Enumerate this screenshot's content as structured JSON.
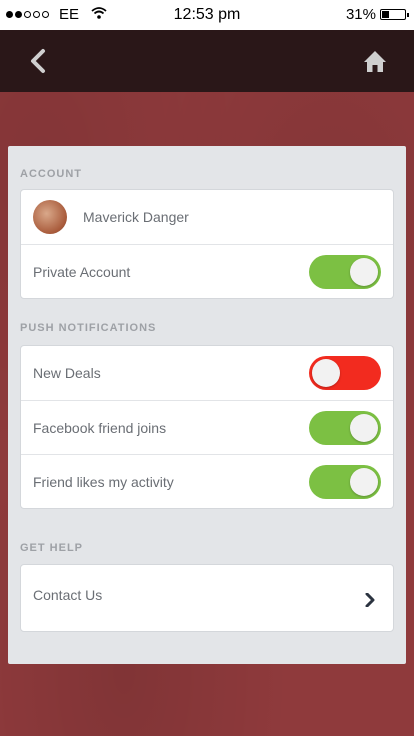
{
  "status_bar": {
    "carrier": "EE",
    "time": "12:53 pm",
    "battery": "31%",
    "signal_strength_filled": 2,
    "signal_strength_total": 5
  },
  "nav": {
    "back_icon": "chevron-left-icon",
    "home_icon": "home-icon"
  },
  "account": {
    "header": "ACCOUNT",
    "user_name": "Maverick Danger",
    "private_label": "Private Account",
    "private_enabled": true
  },
  "push": {
    "header": "PUSH NOTIFICATIONS",
    "items": [
      {
        "label": "New Deals",
        "enabled": false
      },
      {
        "label": "Facebook friend joins",
        "enabled": true
      },
      {
        "label": "Friend likes my activity",
        "enabled": true
      }
    ]
  },
  "help": {
    "header": "GET HELP",
    "contact_label": "Contact Us"
  },
  "colors": {
    "toggle_on": "#7cc043",
    "toggle_off": "#f22b1f",
    "background": "#8f3a3c",
    "nav_bar": "#2a1718"
  }
}
